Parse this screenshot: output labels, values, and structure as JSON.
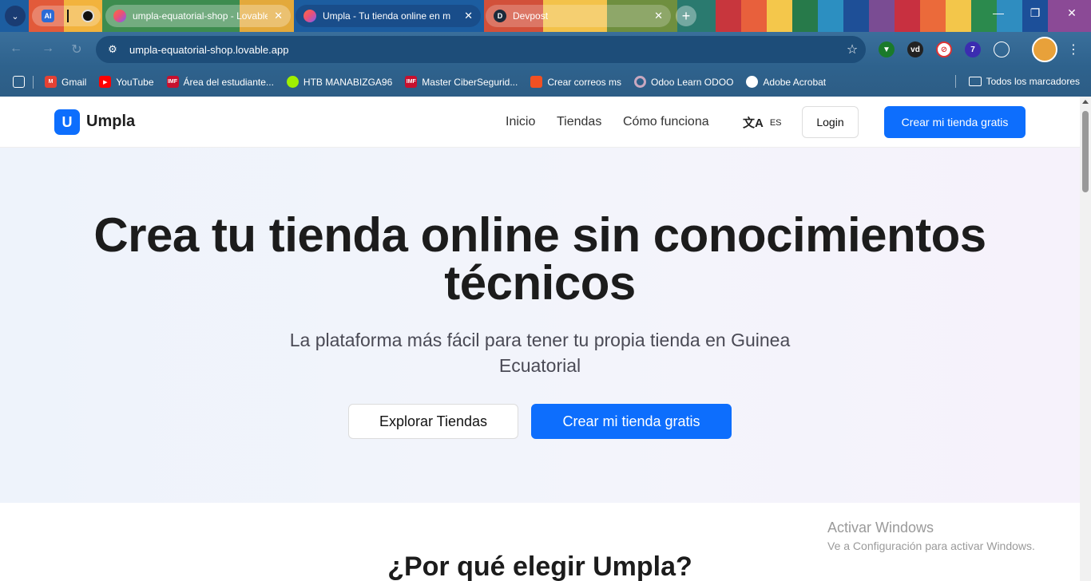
{
  "browser": {
    "pinned": [
      {
        "icon": "AI",
        "color": "#2c6bd6"
      },
      {
        "icon": "",
        "color": "#111111"
      },
      {
        "icon": "",
        "color": "#111111"
      }
    ],
    "tabs": [
      {
        "title": "umpla-equatorial-shop - Lovable",
        "active": false,
        "favicon_color": "#e8507a"
      },
      {
        "title": "Umpla - Tu tienda online en m",
        "active": true,
        "favicon_color": "#e8507a"
      },
      {
        "title": "Devpost",
        "active": false,
        "favicon_color": "#1b2a3a",
        "favicon_letter": "D"
      }
    ],
    "close_glyph": "✕",
    "new_tab_glyph": "+",
    "url": "umpla-equatorial-shop.lovable.app",
    "extension_badge": "7",
    "bookmarks": [
      {
        "label": "Gmail",
        "color": "#e44134",
        "letter": "M"
      },
      {
        "label": "YouTube",
        "color": "#ff0000",
        "letter": "▶"
      },
      {
        "label": "Área del estudiante...",
        "color": "#c8102e",
        "letter": "IMF"
      },
      {
        "label": "HTB MANABIZGA96",
        "color": "#9fef00",
        "letter": ""
      },
      {
        "label": "Master CiberSegurid...",
        "color": "#c8102e",
        "letter": "IMF"
      },
      {
        "label": "Crear correos ms",
        "color": "#f25022",
        "letter": ""
      },
      {
        "label": "Odoo Learn ODOO",
        "color": "#714b67",
        "letter": ""
      },
      {
        "label": "Adobe Acrobat",
        "color": "#ffffff",
        "letter": ""
      }
    ],
    "all_bookmarks": "Todos los marcadores"
  },
  "site": {
    "logo_letter": "U",
    "logo_text": "Umpla",
    "nav": [
      "Inicio",
      "Tiendas",
      "Cómo funciona"
    ],
    "lang": "ES",
    "login": "Login",
    "cta": "Crear mi tienda gratis",
    "accent": "#0d6efd"
  },
  "hero": {
    "title_line1": "Crea tu tienda online sin conocimientos",
    "title_line2": "técnicos",
    "subtitle_line1": "La plataforma más fácil para tener tu propia tienda en Guinea",
    "subtitle_line2": "Ecuatorial",
    "btn_explore": "Explorar Tiendas",
    "btn_create": "Crear mi tienda gratis"
  },
  "section2": {
    "title": "¿Por qué elegir Umpla?"
  },
  "watermark": {
    "line1": "Activar Windows",
    "line2": "Ve a Configuración para activar Windows."
  }
}
